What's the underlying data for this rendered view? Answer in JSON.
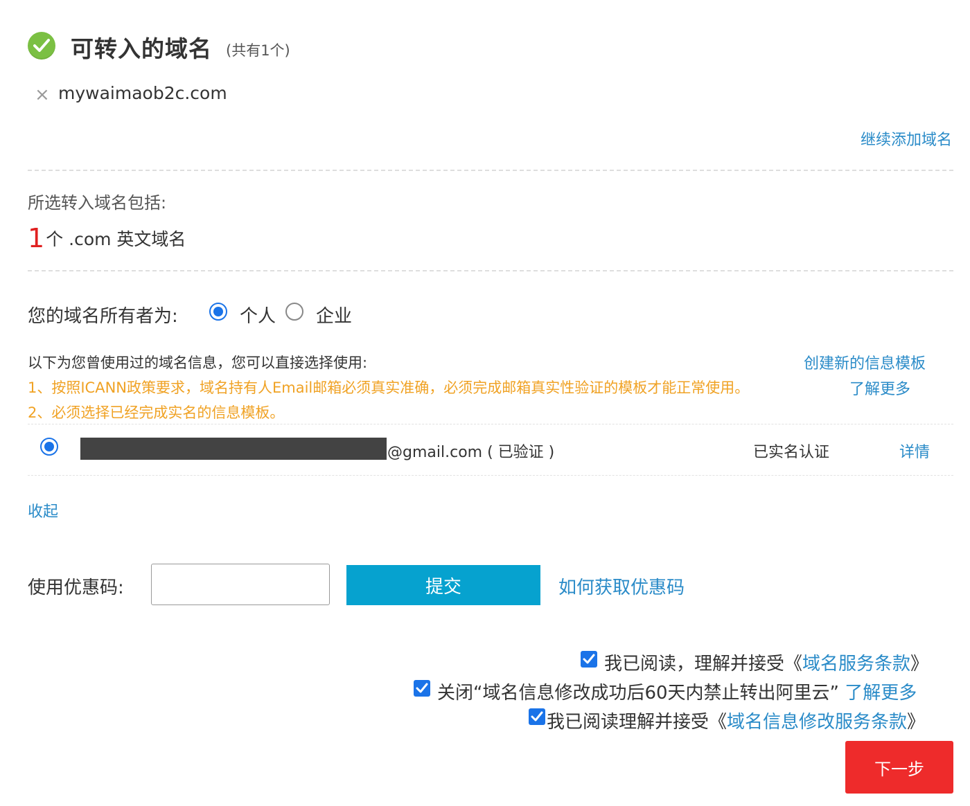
{
  "header": {
    "title": "可转入的域名",
    "count": "(共有1个)"
  },
  "domain": {
    "remove_icon": "close-icon",
    "name": "mywaimaob2c.com"
  },
  "add_domain_link": "继续添加域名",
  "summary": {
    "label": "所选转入域名包括:",
    "count": "1",
    "unit": "个",
    "desc": " .com 英文域名"
  },
  "owner": {
    "label": "您的域名所有者为:",
    "options": [
      {
        "label": "个人",
        "selected": true
      },
      {
        "label": "企业",
        "selected": false
      }
    ]
  },
  "templates": {
    "hint": "以下为您曾使用过的域名信息，您可以直接选择使用:",
    "create_link": "创建新的信息模板",
    "warning_1": "1、按照ICANN政策要求，域名持有人Email邮箱必须真实准确，必须完成邮箱真实性验证的模板才能正常使用。",
    "learn_more": "了解更多",
    "warning_2": "2、必须选择已经完成实名的信息模板。",
    "rows": [
      {
        "email_suffix": "@gmail.com ( 已验证 )",
        "status": "已实名认证",
        "details": "详情",
        "selected": true
      }
    ],
    "collapse_link": "收起"
  },
  "coupon": {
    "label": "使用优惠码:",
    "value": "",
    "placeholder": "",
    "submit": "提交",
    "how_link": "如何获取优惠码"
  },
  "agreements": [
    {
      "text": "我已阅读，理解并接受",
      "open": "《",
      "link": "域名服务条款",
      "close": "》",
      "checked": true
    },
    {
      "text": "关闭“域名信息修改成功后60天内禁止转出阿里云”",
      "link": "了解更多",
      "checked": true
    },
    {
      "text": "我已阅读理解并接受",
      "open": "《",
      "link": "域名信息修改服务条款",
      "close": "》",
      "checked": true
    }
  ],
  "next_button": "下一步",
  "colors": {
    "link": "#2a8bc8",
    "warning": "#f0a224",
    "success": "#7bc043",
    "primary_button": "#06a2cf",
    "next_button": "#ee2b2b",
    "count_highlight": "#e02020"
  }
}
